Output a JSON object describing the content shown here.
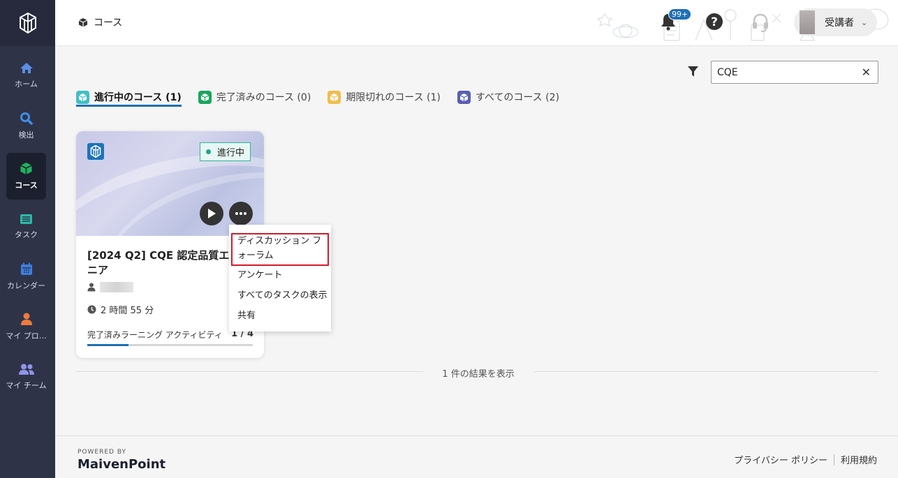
{
  "sidebar": {
    "items": [
      {
        "label": "ホーム",
        "icon": "home-icon"
      },
      {
        "label": "検出",
        "icon": "search-icon"
      },
      {
        "label": "コース",
        "icon": "course-cube-icon",
        "active": true
      },
      {
        "label": "タスク",
        "icon": "task-icon"
      },
      {
        "label": "カレンダー",
        "icon": "calendar-icon"
      },
      {
        "label": "マイ プロ…",
        "icon": "profile-icon"
      },
      {
        "label": "マイ チーム",
        "icon": "team-icon"
      }
    ]
  },
  "header": {
    "breadcrumb": "コース",
    "notification_badge": "99+",
    "user_name": "受講者"
  },
  "search": {
    "value": "CQE",
    "clear_label": "✕"
  },
  "tabs": [
    {
      "label": "進行中のコース (1)",
      "color": "#3fbfc7",
      "active": true
    },
    {
      "label": "完了済みのコース (0)",
      "color": "#1aa55c"
    },
    {
      "label": "期限切れのコース (1)",
      "color": "#f1bd4e"
    },
    {
      "label": "すべてのコース (2)",
      "color": "#5a5fb0"
    }
  ],
  "course_card": {
    "status": "進行中",
    "title": "[2024 Q2] CQE 認定品質エンジニア",
    "duration": "2 時間 55 分",
    "progress_label": "完了済みラーニング アクティビティ",
    "progress_count": "1 / 4",
    "progress_fraction": 0.25
  },
  "menu": {
    "items": [
      "ディスカッション フォーラム",
      "アンケート",
      "すべてのタスクの表示",
      "共有"
    ]
  },
  "results": {
    "text": "1 件の結果を表示"
  },
  "footer": {
    "powered_by": "POWERED BY",
    "brand_main": "MaivenPoint",
    "privacy": "プライバシー ポリシー",
    "terms": "利用規約"
  }
}
